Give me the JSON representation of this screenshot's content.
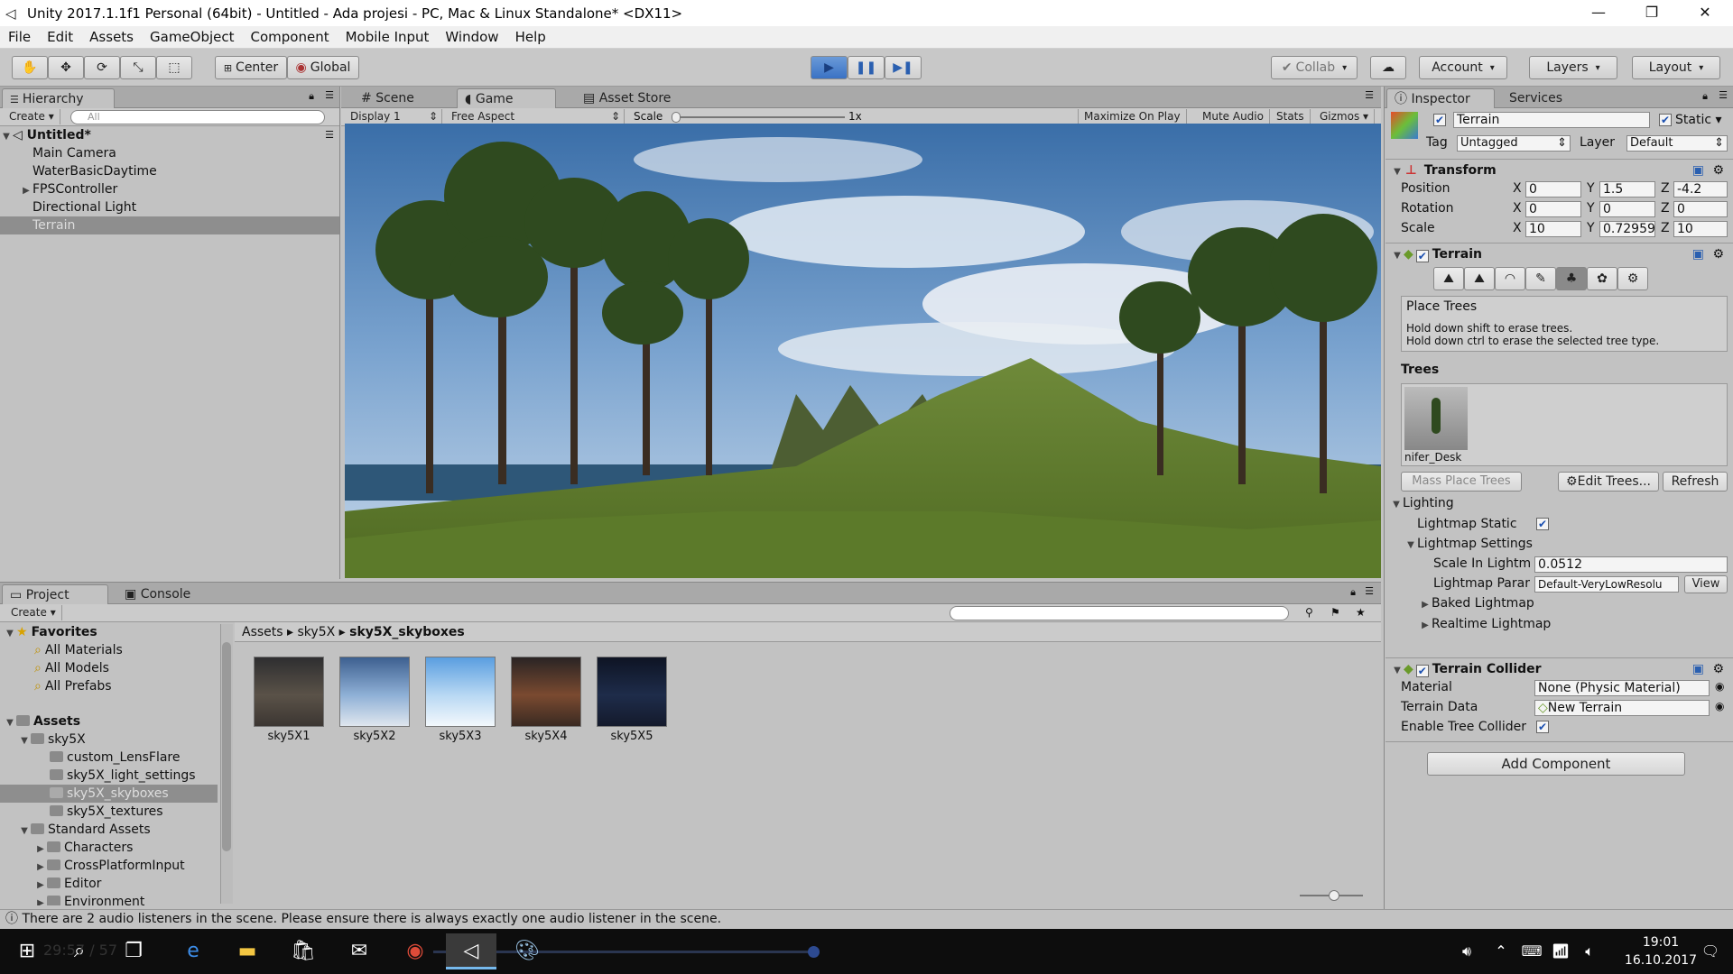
{
  "window": {
    "title": "Unity 2017.1.1f1 Personal (64bit) - Untitled - Ada projesi - PC, Mac & Linux Standalone* <DX11>",
    "minimize": "—",
    "restore": "❐",
    "close": "✕"
  },
  "menu": [
    "File",
    "Edit",
    "Assets",
    "GameObject",
    "Component",
    "Mobile Input",
    "Window",
    "Help"
  ],
  "toolbar": {
    "center": "Center",
    "global": "Global",
    "collab": "Collab",
    "account": "Account",
    "layers": "Layers",
    "layout": "Layout"
  },
  "hierarchy": {
    "tab": "Hierarchy",
    "create": "Create",
    "search_placeholder": "All",
    "scene": "Untitled*",
    "items": [
      "Main Camera",
      "WaterBasicDaytime",
      "FPSController",
      "Directional Light",
      "Terrain"
    ]
  },
  "center_tabs": {
    "scene": "Scene",
    "game": "Game",
    "asset_store": "Asset Store"
  },
  "game_bar": {
    "display": "Display 1",
    "aspect": "Free Aspect",
    "scale_label": "Scale",
    "scale_value": "1x",
    "maximize": "Maximize On Play",
    "mute": "Mute Audio",
    "stats": "Stats",
    "gizmos": "Gizmos"
  },
  "project": {
    "tab": "Project",
    "console_tab": "Console",
    "create": "Create",
    "favorites": "Favorites",
    "fav_items": [
      "All Materials",
      "All Models",
      "All Prefabs"
    ],
    "assets": "Assets",
    "tree": [
      {
        "label": "sky5X",
        "depth": 1,
        "open": true
      },
      {
        "label": "custom_LensFlare",
        "depth": 2
      },
      {
        "label": "sky5X_light_settings",
        "depth": 2
      },
      {
        "label": "sky5X_skyboxes",
        "depth": 2,
        "selected": true
      },
      {
        "label": "sky5X_textures",
        "depth": 2
      },
      {
        "label": "Standard Assets",
        "depth": 1,
        "open": true
      },
      {
        "label": "Characters",
        "depth": 2,
        "closed": true
      },
      {
        "label": "CrossPlatformInput",
        "depth": 2,
        "closed": true
      },
      {
        "label": "Editor",
        "depth": 2,
        "closed": true
      },
      {
        "label": "Environment",
        "depth": 2,
        "closed": true
      }
    ],
    "breadcrumb": [
      "Assets",
      "sky5X",
      "sky5X_skyboxes"
    ],
    "thumbs": [
      "sky5X1",
      "sky5X2",
      "sky5X3",
      "sky5X4",
      "sky5X5"
    ]
  },
  "inspector": {
    "tab": "Inspector",
    "services_tab": "Services",
    "object_name": "Terrain",
    "static": "Static",
    "tag_label": "Tag",
    "tag_value": "Untagged",
    "layer_label": "Layer",
    "layer_value": "Default",
    "transform": {
      "title": "Transform",
      "position": {
        "label": "Position",
        "x": "0",
        "y": "1.5",
        "z": "-4.2"
      },
      "rotation": {
        "label": "Rotation",
        "x": "0",
        "y": "0",
        "z": "0"
      },
      "scale": {
        "label": "Scale",
        "x": "10",
        "y": "0.72959",
        "z": "10"
      }
    },
    "terrain": {
      "title": "Terrain",
      "place_trees": "Place Trees",
      "hint1": "Hold down shift to erase trees.",
      "hint2": "Hold down ctrl to erase the selected tree type.",
      "trees_header": "Trees",
      "tree_name": "nifer_Desk",
      "mass_place": "Mass Place Trees",
      "edit_trees": "Edit Trees...",
      "refresh": "Refresh",
      "lighting": "Lighting",
      "lightmap_static": "Lightmap Static",
      "lightmap_settings": "Lightmap Settings",
      "scale_in_lightmap": "Scale In Lightm",
      "scale_in_lightmap_value": "0.0512",
      "lightmap_params": "Lightmap Parar",
      "lightmap_params_value": "Default-VeryLowResolu",
      "view": "View",
      "baked_lightmap": "Baked Lightmap",
      "realtime_lightmap": "Realtime Lightmap"
    },
    "collider": {
      "title": "Terrain Collider",
      "material_label": "Material",
      "material_value": "None (Physic Material)",
      "data_label": "Terrain Data",
      "data_value": "New Terrain",
      "enable_tree": "Enable Tree Collider"
    },
    "add_component": "Add Component"
  },
  "status": "There are 2 audio listeners in the scene. Please ensure there is always exactly one audio listener in the scene.",
  "taskbar": {
    "time": "19:01",
    "date": "16.10.2017",
    "overlay_text": "29:57 / 57"
  },
  "colors": {
    "play_active": "#3a72c4",
    "selection": "#8e8e8e",
    "panel_bg": "#c2c2c2",
    "taskbar_bg": "#0d0d0d"
  }
}
